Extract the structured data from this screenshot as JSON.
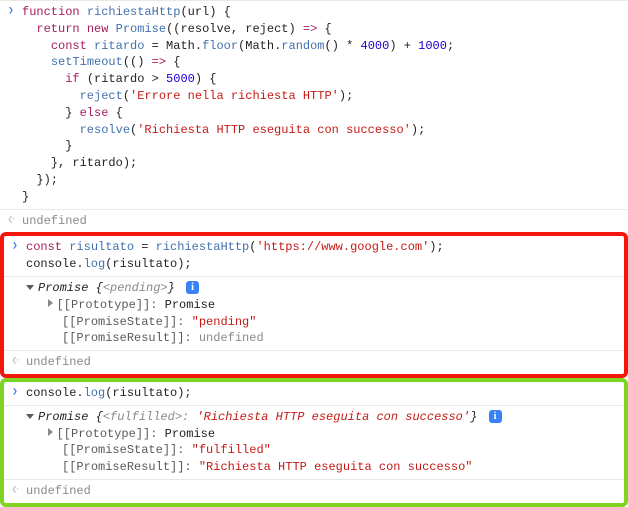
{
  "code1": {
    "l1": "function richiestaHttp(url) {",
    "l2": "  return new Promise((resolve, reject) => {",
    "l3": "    const ritardo = Math.floor(Math.random() * 4000) + 1000;",
    "l4": "    setTimeout(() => {",
    "l5": "      if (ritardo > 5000) {",
    "l6": "        reject('Errore nella richiesta HTTP');",
    "l7": "      } else {",
    "l8": "        resolve('Richiesta HTTP eseguita con successo');",
    "l9": "      }",
    "l10": "    }, ritardo);",
    "l11": "  });",
    "l12": "}"
  },
  "out_undef": "undefined",
  "code2": {
    "l1": "const risultato = richiestaHttp('https://www.google.com');",
    "l2": "console.log(risultato);"
  },
  "promise_pending": {
    "header_prefix": "Promise ",
    "header_state": "<pending>",
    "proto_label": "[[Prototype]]: ",
    "proto_value": "Promise",
    "state_label": "[[PromiseState]]: ",
    "state_value": "\"pending\"",
    "result_label": "[[PromiseResult]]: ",
    "result_value": "undefined"
  },
  "code3": {
    "l1": "console.log(risultato);"
  },
  "promise_fulfilled": {
    "header_prefix": "Promise ",
    "header_state": "<fulfilled>",
    "header_sep": ": ",
    "header_value": "'Richiesta HTTP eseguita con successo'",
    "proto_label": "[[Prototype]]: ",
    "proto_value": "Promise",
    "state_label": "[[PromiseState]]: ",
    "state_value": "\"fulfilled\"",
    "result_label": "[[PromiseResult]]: ",
    "result_value": "\"Richiesta HTTP eseguita con successo\""
  },
  "info_badge": "i"
}
